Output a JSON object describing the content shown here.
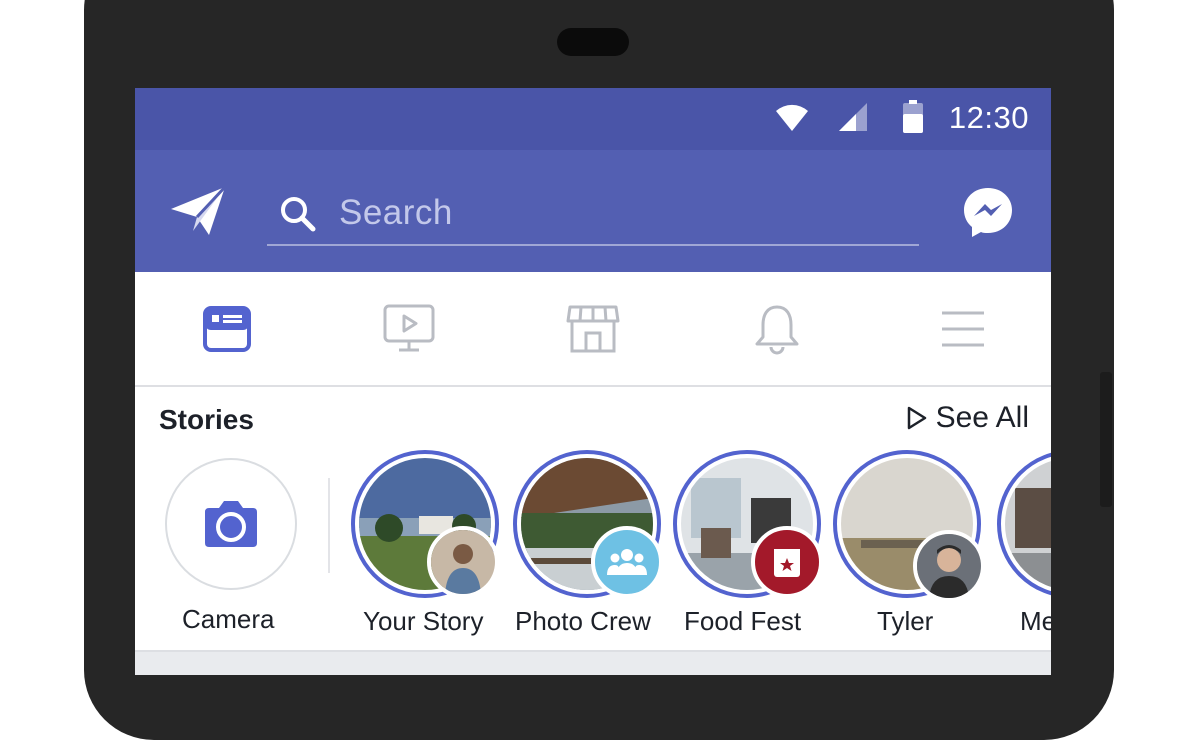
{
  "status_bar": {
    "time": "12:30",
    "icons": [
      "wifi-icon",
      "cellular-signal-icon",
      "battery-icon"
    ]
  },
  "header": {
    "left_icon": "paper-plane-icon",
    "search_placeholder": "Search",
    "right_icon": "messenger-icon"
  },
  "tabs": [
    {
      "name": "news-feed",
      "icon": "news-feed-icon",
      "active": true
    },
    {
      "name": "watch",
      "icon": "video-monitor-icon",
      "active": false
    },
    {
      "name": "marketplace",
      "icon": "storefront-icon",
      "active": false
    },
    {
      "name": "notifications",
      "icon": "bell-icon",
      "active": false
    },
    {
      "name": "menu",
      "icon": "hamburger-menu-icon",
      "active": false
    }
  ],
  "stories": {
    "title": "Stories",
    "see_all": "See All",
    "camera_label": "Camera",
    "items": [
      {
        "label": "Your Story"
      },
      {
        "label": "Photo Crew"
      },
      {
        "label": "Food Fest"
      },
      {
        "label": "Tyler"
      },
      {
        "label": "Me"
      }
    ]
  },
  "colors": {
    "status_bar": "#4a55a8",
    "app_bar": "#535fb2",
    "accent": "#5363cf",
    "inactive_icon": "#b9bcc3"
  }
}
